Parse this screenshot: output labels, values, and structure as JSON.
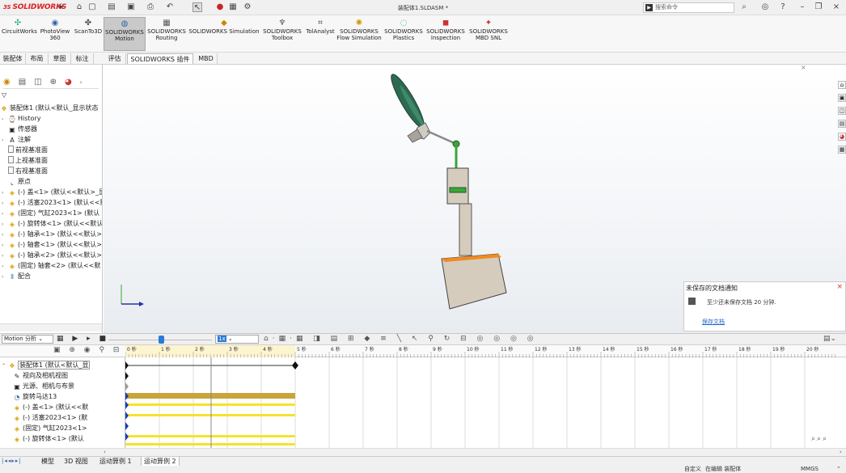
{
  "titlebar": {
    "brand": "SOLIDWORKS",
    "title": "装配体1.SLDASM *",
    "search_placeholder": "搜索命令"
  },
  "commands": [
    {
      "label": "CircuitWorks",
      "icon": "circuit-icon"
    },
    {
      "label": "PhotoView\n360",
      "icon": "photoview-icon"
    },
    {
      "label": "ScanTo3D",
      "icon": "scan-icon"
    },
    {
      "label": "SOLIDWORKS\nMotion",
      "icon": "motion-icon",
      "active": true
    },
    {
      "label": "SOLIDWORKS\nRouting",
      "icon": "routing-icon"
    },
    {
      "label": "SOLIDWORKS Simulation",
      "icon": "simulation-icon"
    },
    {
      "label": "SOLIDWORKS\nToolbox",
      "icon": "toolbox-icon"
    },
    {
      "label": "TolAnalyst",
      "icon": "tolanalyst-icon"
    },
    {
      "label": "SOLIDWORKS\nFlow Simulation",
      "icon": "flow-icon"
    },
    {
      "label": "SOLIDWORKS\nPlastics",
      "icon": "plastics-icon"
    },
    {
      "label": "SOLIDWORKS\nInspection",
      "icon": "inspection-icon"
    },
    {
      "label": "SOLIDWORKS\nMBD SNL",
      "icon": "mbd-icon"
    }
  ],
  "tabs": [
    "装配体",
    "布局",
    "草图",
    "标注",
    "评估",
    "SOLIDWORKS 插件",
    "MBD"
  ],
  "selected_tab": "SOLIDWORKS 插件",
  "tree": {
    "root": "装配体1 (默认<默认_显示状态",
    "items": [
      {
        "label": "History",
        "icon": "history-icon"
      },
      {
        "label": "传感器",
        "icon": "sensor-icon"
      },
      {
        "label": "注解",
        "icon": "annotation-icon"
      },
      {
        "label": "前视基准面",
        "icon": "plane-icon"
      },
      {
        "label": "上视基准面",
        "icon": "plane-icon"
      },
      {
        "label": "右视基准面",
        "icon": "plane-icon"
      },
      {
        "label": "原点",
        "icon": "origin-icon"
      },
      {
        "label": "(-) 盖<1> (默认<<默认>_显",
        "icon": "part-icon"
      },
      {
        "label": "(-) 活塞2023<1> (默认<<默认",
        "icon": "part-icon"
      },
      {
        "label": "(固定) 气缸2023<1> (默认",
        "icon": "part-icon"
      },
      {
        "label": "(-) 旋转体<1> (默认<<默认",
        "icon": "part-icon"
      },
      {
        "label": "(-) 轴承<1> (默认<<默认>",
        "icon": "part-icon"
      },
      {
        "label": "(-) 轴套<1> (默认<<默认>",
        "icon": "part-icon"
      },
      {
        "label": "(-) 轴承<2> (默认<<默认>",
        "icon": "part-icon"
      },
      {
        "label": "(固定) 轴套<2> (默认<<默",
        "icon": "part-icon"
      },
      {
        "label": "配合",
        "icon": "mates-icon"
      }
    ]
  },
  "notification": {
    "title": "未保存的文档通知",
    "message": "至少还未保存文档 20 分钟.",
    "link": "保存文档"
  },
  "motion": {
    "study_type": "Motion 分析",
    "speed_value": "1x",
    "timeline_labels": [
      "0 秒",
      "1 秒",
      "2 秒",
      "3 秒",
      "4 秒",
      "5 秒",
      "6 秒",
      "7 秒",
      "8 秒",
      "9 秒",
      "10 秒",
      "11 秒",
      "12 秒",
      "13 秒",
      "14 秒",
      "15 秒",
      "16 秒",
      "17 秒",
      "18 秒",
      "19 秒",
      "20 秒"
    ],
    "tree": [
      "装配体1 (默认<默认_显",
      "视向及相机视图",
      "光源、相机与布景",
      "旋转马达13",
      "(-) 盖<1> (默认<<默",
      "(-) 活塞2023<1> (默",
      "(固定) 气缸2023<1>",
      "(-) 旋转体<1> (默认"
    ]
  },
  "bottom_tabs": [
    "模型",
    "3D 视图",
    "运动算例 1",
    "运动算例 2"
  ],
  "selected_bottom_tab": "运动算例 2",
  "status": {
    "custom": "自定义",
    "editing": "在编辑 装配体",
    "units": "MMGS"
  }
}
